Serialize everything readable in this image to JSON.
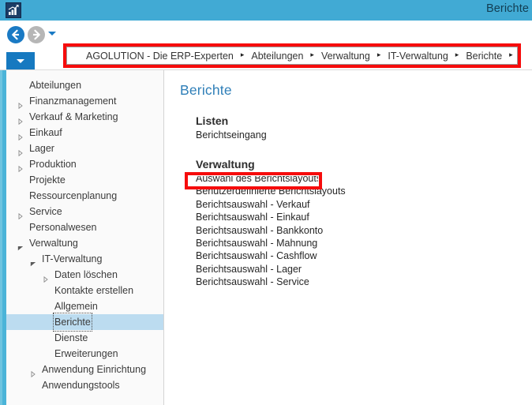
{
  "window": {
    "title": "Berichte",
    "app_icon": "bar-chart-icon"
  },
  "navigation": {
    "back_icon": "arrow-left-icon",
    "forward_icon": "arrow-right-icon",
    "history_dropdown_icon": "chevron-down-icon",
    "address_dropdown_icon": "chevron-down-icon",
    "breadcrumb_separator": "▸",
    "breadcrumb": [
      "AGOLUTION - Die ERP-Experten",
      "Abteilungen",
      "Verwaltung",
      "IT-Verwaltung",
      "Berichte"
    ]
  },
  "sidebar": {
    "items": [
      {
        "label": "Abteilungen",
        "indent": 0,
        "arrow": "none"
      },
      {
        "label": "Finanzmanagement",
        "indent": 0,
        "arrow": "collapsed"
      },
      {
        "label": "Verkauf & Marketing",
        "indent": 0,
        "arrow": "collapsed"
      },
      {
        "label": "Einkauf",
        "indent": 0,
        "arrow": "collapsed"
      },
      {
        "label": "Lager",
        "indent": 0,
        "arrow": "collapsed"
      },
      {
        "label": "Produktion",
        "indent": 0,
        "arrow": "collapsed"
      },
      {
        "label": "Projekte",
        "indent": 0,
        "arrow": "none"
      },
      {
        "label": "Ressourcenplanung",
        "indent": 0,
        "arrow": "none"
      },
      {
        "label": "Service",
        "indent": 0,
        "arrow": "collapsed"
      },
      {
        "label": "Personalwesen",
        "indent": 0,
        "arrow": "none"
      },
      {
        "label": "Verwaltung",
        "indent": 0,
        "arrow": "expanded"
      },
      {
        "label": "IT-Verwaltung",
        "indent": 1,
        "arrow": "expanded"
      },
      {
        "label": "Daten löschen",
        "indent": 2,
        "arrow": "collapsed"
      },
      {
        "label": "Kontakte erstellen",
        "indent": 2,
        "arrow": "none"
      },
      {
        "label": "Allgemein",
        "indent": 2,
        "arrow": "none"
      },
      {
        "label": "Berichte",
        "indent": 2,
        "arrow": "none",
        "selected": true
      },
      {
        "label": "Dienste",
        "indent": 2,
        "arrow": "none"
      },
      {
        "label": "Erweiterungen",
        "indent": 2,
        "arrow": "none"
      },
      {
        "label": "Anwendung Einrichtung",
        "indent": 1,
        "arrow": "collapsed"
      },
      {
        "label": "Anwendungstools",
        "indent": 1,
        "arrow": "none"
      }
    ]
  },
  "content": {
    "page_title": "Berichte",
    "groups": [
      {
        "heading": "Listen",
        "links": [
          "Berichtseingang"
        ]
      },
      {
        "heading": "Verwaltung",
        "links": [
          "Auswahl des Berichtslayouts",
          "Benutzerdefinierte Berichtslayouts",
          "Berichtsauswahl - Verkauf",
          "Berichtsauswahl - Einkauf",
          "Berichtsauswahl - Bankkonto",
          "Berichtsauswahl - Mahnung",
          "Berichtsauswahl - Cashflow",
          "Berichtsauswahl - Lager",
          "Berichtsauswahl - Service"
        ]
      }
    ]
  },
  "annotations": {
    "highlight_color": "#f60c0c",
    "breadcrumb_highlight_target": "breadcrumb-bar",
    "link_highlight_target": "Auswahl des Berichtslayouts"
  },
  "colors": {
    "titlebar": "#41aad4",
    "accent_strip": "#4bb4d8",
    "selection": "#bcdcf0",
    "page_title": "#2f7fb8",
    "nav_back": "#1a7ac4",
    "nav_forward": "#b6b6b6"
  }
}
